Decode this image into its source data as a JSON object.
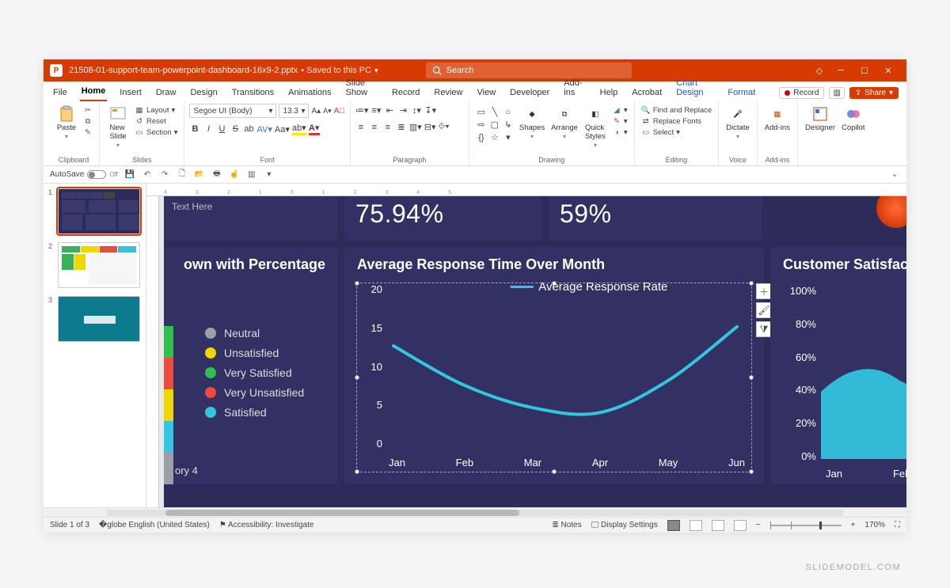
{
  "titlebar": {
    "filename": "21508-01-support-team-powerpoint-dashboard-16x9-2.pptx",
    "saved": "Saved to this PC",
    "search": "Search"
  },
  "tabs": {
    "items": [
      "File",
      "Home",
      "Insert",
      "Draw",
      "Design",
      "Transitions",
      "Animations",
      "Slide Show",
      "Record",
      "Review",
      "View",
      "Developer",
      "Add-ins",
      "Help",
      "Acrobat",
      "Chart Design",
      "Format"
    ],
    "active": "Home",
    "record_btn": "Record",
    "share_btn": "Share"
  },
  "ribbon": {
    "clipboard": {
      "paste": "Paste",
      "label": "Clipboard"
    },
    "slides": {
      "new": "New\nSlide",
      "layout": "Layout",
      "reset": "Reset",
      "section": "Section",
      "label": "Slides"
    },
    "font": {
      "family": "Segoe UI (Body)",
      "size": "13.3",
      "label": "Font"
    },
    "paragraph": {
      "label": "Paragraph"
    },
    "drawing": {
      "shapes": "Shapes",
      "arrange": "Arrange",
      "quick": "Quick\nStyles",
      "label": "Drawing"
    },
    "editing": {
      "find": "Find and Replace",
      "replace": "Replace Fonts",
      "select": "Select",
      "label": "Editing"
    },
    "voice": {
      "dictate": "Dictate",
      "label": "Voice"
    },
    "addins": {
      "addins": "Add-ins",
      "label": "Add-ins"
    },
    "designer": "Designer",
    "copilot": "Copilot"
  },
  "qat": {
    "autosave": "AutoSave",
    "off": "Off"
  },
  "thumbnails": [
    {
      "num": "1"
    },
    {
      "num": "2"
    },
    {
      "num": "3"
    }
  ],
  "slide": {
    "text_here": "Text Here",
    "metric1": "75.94%",
    "metric2": "59%",
    "card_left_title": "own with Percentage",
    "card_mid_title": "Average Response Time Over Month",
    "card_right_title": "Customer Satisfac",
    "category4": "ory 4",
    "legend": [
      {
        "label": "Neutral",
        "color": "#9aa0a6"
      },
      {
        "label": "Unsatisfied",
        "color": "#f2d600"
      },
      {
        "label": "Very Satisfied",
        "color": "#2fbf4c"
      },
      {
        "label": "Very Unsatisfied",
        "color": "#ef4b3c"
      },
      {
        "label": "Satisfied",
        "color": "#33c6e0"
      }
    ]
  },
  "chart_data": {
    "type": "line",
    "title": "Average Response Time Over Month",
    "series_name": "Average Response Rate",
    "categories": [
      "Jan",
      "Feb",
      "Mar",
      "Apr",
      "May",
      "Jun"
    ],
    "values": [
      13.5,
      8.5,
      5.5,
      4.8,
      9,
      16
    ],
    "ylim": [
      0,
      20
    ],
    "yticks": [
      20,
      15,
      10,
      5,
      0
    ],
    "line_color": "#33c6e0"
  },
  "right_chart": {
    "yticks": [
      "100%",
      "80%",
      "60%",
      "40%",
      "20%",
      "0%"
    ],
    "xticks": [
      "Jan",
      "Feb"
    ]
  },
  "status": {
    "slide": "Slide 1 of 3",
    "lang": "English (United States)",
    "access": "Accessibility: Investigate",
    "notes": "Notes",
    "display": "Display Settings",
    "zoom": "170%"
  },
  "watermark": "SLIDEMODEL.COM"
}
